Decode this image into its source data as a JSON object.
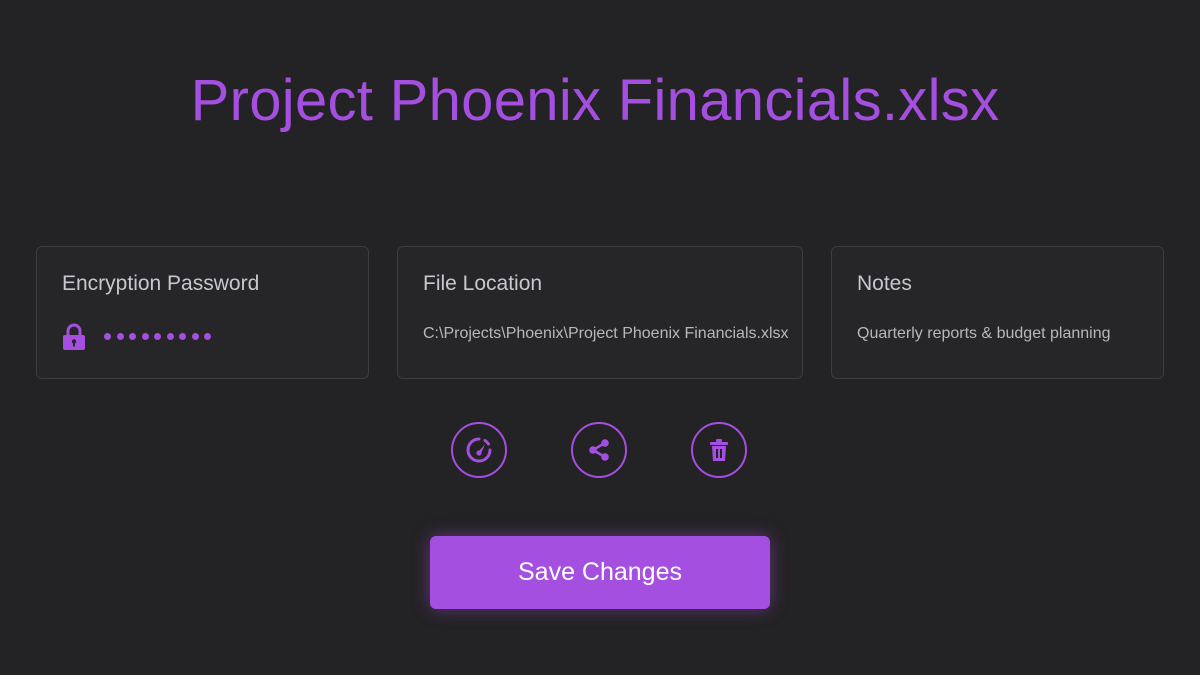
{
  "file": {
    "title": "Project Phoenix Financials.xlsx"
  },
  "cards": {
    "password": {
      "label": "Encryption Password",
      "masked_value": "•••••••••",
      "dot_count": 9,
      "icon": "lock-icon"
    },
    "location": {
      "label": "File Location",
      "value": "C:\\Projects\\Phoenix\\Project Phoenix Financials.xlsx"
    },
    "notes": {
      "label": "Notes",
      "value": "Quarterly reports & budget planning"
    }
  },
  "actions": [
    {
      "name": "speed-gauge-icon"
    },
    {
      "name": "share-icon"
    },
    {
      "name": "trash-icon"
    }
  ],
  "save_button": {
    "label": "Save Changes"
  },
  "colors": {
    "background": "#232224",
    "accent": "#a54fe0",
    "card_border": "#3d3c40",
    "label_text": "#c9c7cc"
  }
}
